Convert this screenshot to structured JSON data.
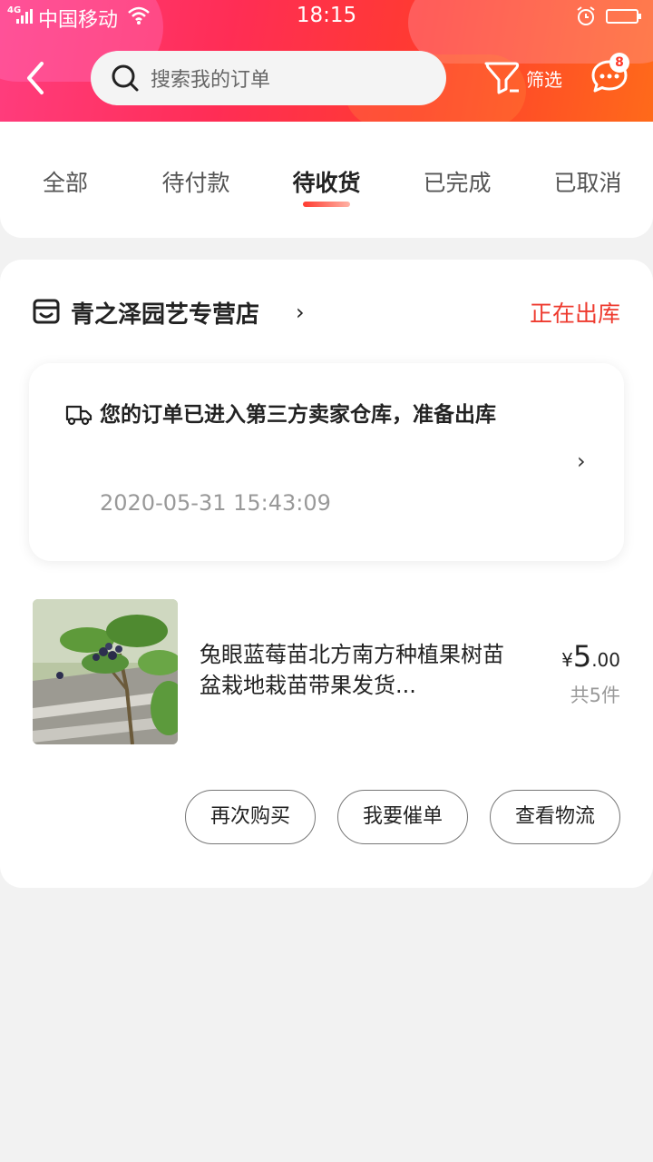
{
  "status_bar": {
    "network": "4G",
    "carrier": "中国移动",
    "time": "18:15"
  },
  "header": {
    "search_placeholder": "搜索我的订单",
    "filter_label": "筛选",
    "message_badge": "8"
  },
  "tabs": [
    {
      "label": "全部",
      "active": false
    },
    {
      "label": "待付款",
      "active": false
    },
    {
      "label": "待收货",
      "active": true
    },
    {
      "label": "已完成",
      "active": false
    },
    {
      "label": "已取消",
      "active": false
    }
  ],
  "order": {
    "shop_name": "青之泽园艺专营店",
    "status": "正在出库",
    "logistics": {
      "message": "您的订单已进入第三方卖家仓库，准备出库",
      "time": "2020-05-31 15:43:09"
    },
    "product": {
      "title": "兔眼蓝莓苗北方南方种植果树苗盆栽地栽苗带果发货...",
      "price_currency": "¥",
      "price_int": "5",
      "price_dec": ".00",
      "quantity": "共5件"
    },
    "actions": [
      "再次购买",
      "我要催单",
      "查看物流"
    ]
  },
  "colors": {
    "accent": "#ee3b2f",
    "header_gradient_start": "#ff3d7f",
    "header_gradient_end": "#ff6a1a"
  }
}
